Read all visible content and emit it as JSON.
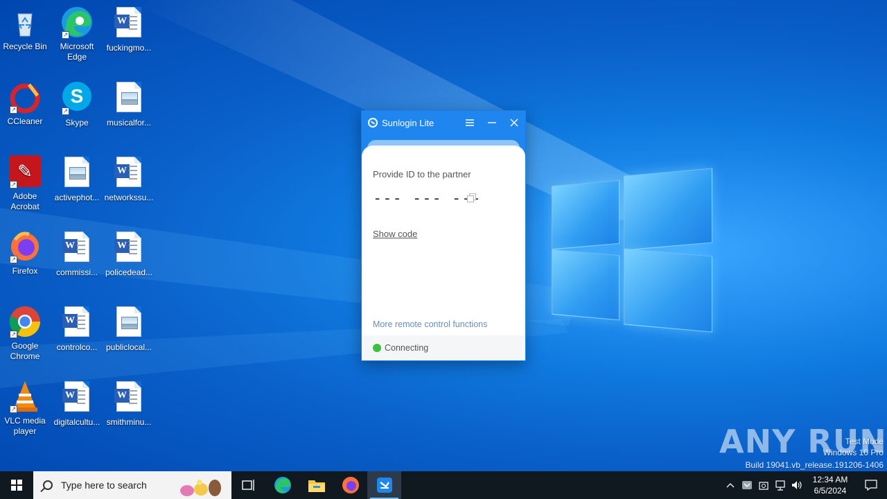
{
  "desktop": {
    "icons": [
      {
        "label": "Recycle Bin",
        "icon": "recycle-bin-icon"
      },
      {
        "label": "Microsoft Edge",
        "icon": "edge-icon"
      },
      {
        "label": "fuckingmo...",
        "icon": "word-doc-icon"
      },
      {
        "label": "CCleaner",
        "icon": "ccleaner-icon"
      },
      {
        "label": "Skype",
        "icon": "skype-icon"
      },
      {
        "label": "musicalfor...",
        "icon": "image-file-icon"
      },
      {
        "label": "Adobe Acrobat",
        "icon": "acrobat-icon"
      },
      {
        "label": "activephot...",
        "icon": "image-file-icon"
      },
      {
        "label": "networkssu...",
        "icon": "word-doc-icon"
      },
      {
        "label": "Firefox",
        "icon": "firefox-icon"
      },
      {
        "label": "commissi...",
        "icon": "word-doc-icon"
      },
      {
        "label": "policedead...",
        "icon": "word-doc-icon"
      },
      {
        "label": "Google Chrome",
        "icon": "chrome-icon"
      },
      {
        "label": "controlco...",
        "icon": "word-doc-icon"
      },
      {
        "label": "publiclocal...",
        "icon": "image-file-icon"
      },
      {
        "label": "VLC media player",
        "icon": "vlc-icon"
      },
      {
        "label": "digitalcultu...",
        "icon": "word-doc-icon"
      },
      {
        "label": "smithminu...",
        "icon": "word-doc-icon"
      }
    ]
  },
  "sunlogin": {
    "title": "Sunlogin Lite",
    "provide_label": "Provide ID to the partner",
    "id_value": "--- --- ---",
    "show_code": "Show code",
    "more_functions": "More remote control functions",
    "status": "Connecting",
    "status_color": "#3cc23a",
    "accent_color": "#1f86f0"
  },
  "watermark": {
    "brand": "ANY RUN",
    "line1": "Test Mode",
    "line2": "Windows 10 Pro",
    "line3": "Build 19041.vb_release.191206-1406"
  },
  "taskbar": {
    "search_placeholder": "Type here to search",
    "clock_time": "12:34 AM",
    "clock_date": "6/5/2024"
  }
}
